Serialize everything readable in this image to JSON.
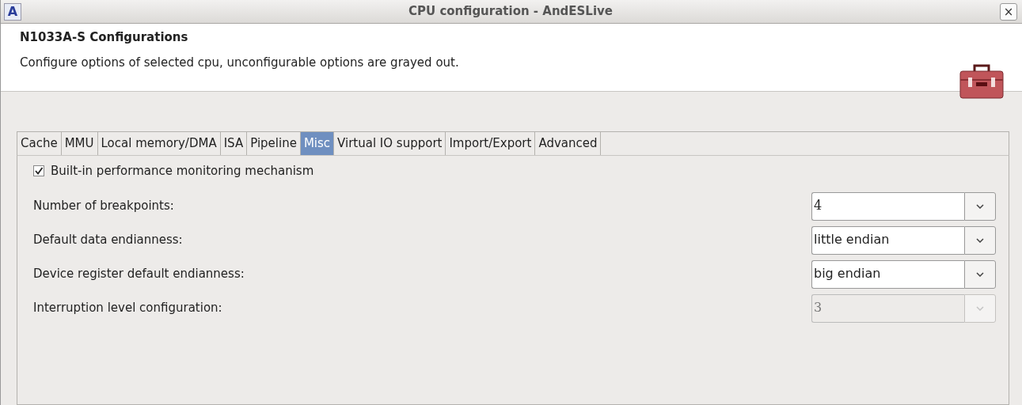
{
  "window": {
    "app_icon": "A",
    "title": "CPU configuration - AndESLive",
    "close": "×"
  },
  "header": {
    "title": "N1033A-S Configurations",
    "description": "Configure options of selected cpu, unconfigurable options are grayed out."
  },
  "tabs": [
    {
      "label": "Cache",
      "selected": false
    },
    {
      "label": "MMU",
      "selected": false
    },
    {
      "label": "Local memory/DMA",
      "selected": false
    },
    {
      "label": "ISA",
      "selected": false
    },
    {
      "label": "Pipeline",
      "selected": false
    },
    {
      "label": "Misc",
      "selected": true
    },
    {
      "label": "Virtual IO support",
      "selected": false
    },
    {
      "label": "Import/Export",
      "selected": false
    },
    {
      "label": "Advanced",
      "selected": false
    }
  ],
  "checkbox": {
    "label": "Built-in performance monitoring mechanism",
    "checked": true
  },
  "settings": [
    {
      "label": "Number of breakpoints:",
      "value": "4",
      "disabled": false
    },
    {
      "label": "Default data endianness:",
      "value": "little endian",
      "disabled": false
    },
    {
      "label": "Device register default endianness:",
      "value": "big endian",
      "disabled": false
    },
    {
      "label": "Interruption level configuration:",
      "value": "3",
      "disabled": true
    }
  ]
}
